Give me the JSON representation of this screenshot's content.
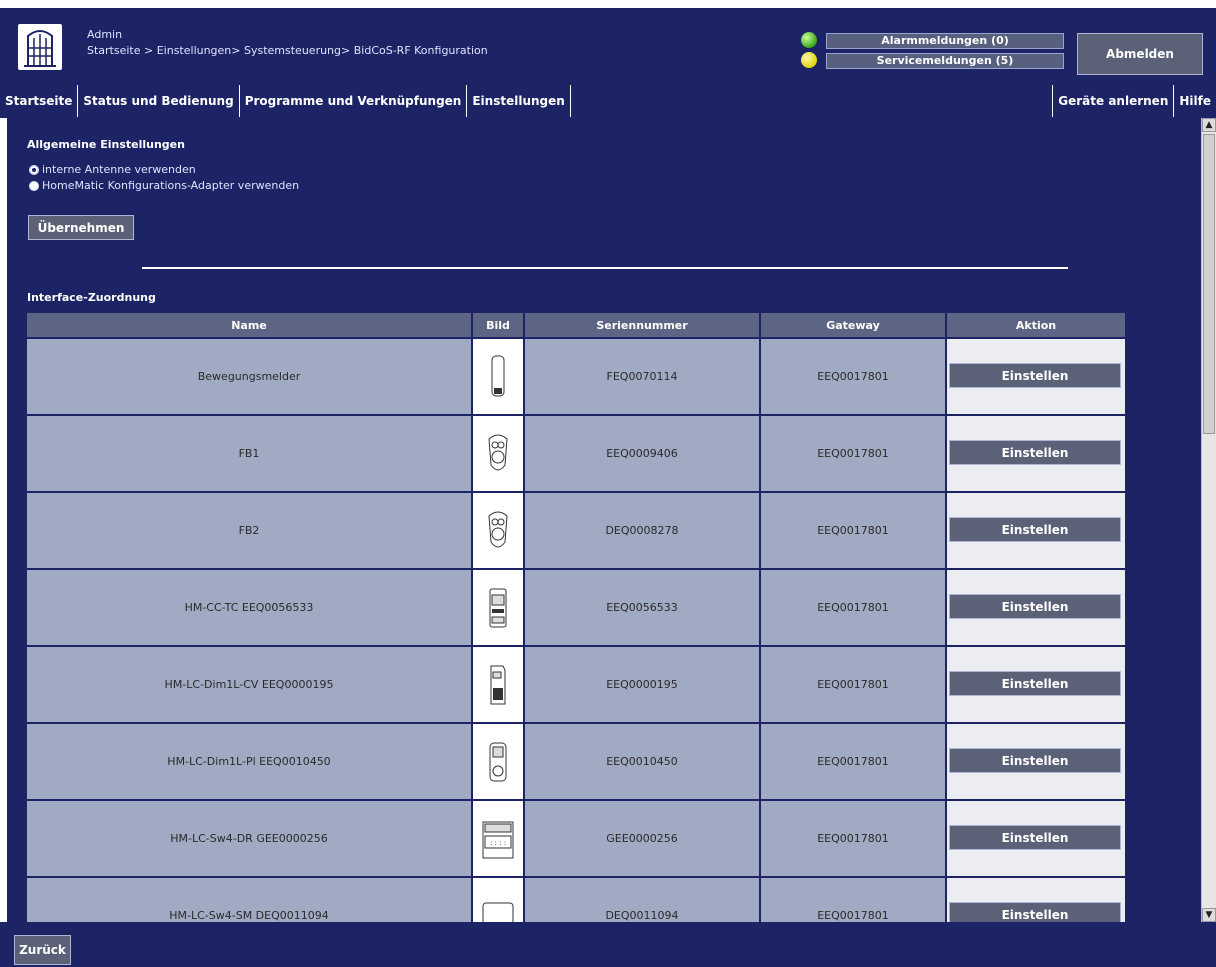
{
  "header": {
    "user": "Admin",
    "breadcrumb": "Startseite > Einstellungen> Systemsteuerung> BidCoS-RF Konfiguration",
    "alarm": "Alarmmeldungen (0)",
    "service": "Servicemeldungen (5)",
    "logout": "Abmelden"
  },
  "nav": {
    "left": [
      "Startseite",
      "Status und Bedienung",
      "Programme und Verknüpfungen",
      "Einstellungen"
    ],
    "right": [
      "Geräte anlernen",
      "Hilfe"
    ]
  },
  "general": {
    "title": "Allgemeine Einstellungen",
    "radio1": "interne Antenne verwenden",
    "radio2": "HomeMatic Konfigurations-Adapter verwenden",
    "apply": "Übernehmen"
  },
  "interface": {
    "title": "Interface-Zuordnung",
    "headers": [
      "Name",
      "Bild",
      "Seriennummer",
      "Gateway",
      "Aktion"
    ],
    "rows": [
      {
        "name": "Bewegungsmelder",
        "serial": "FEQ0070114",
        "gateway": "EEQ0017801",
        "action": "Einstellen",
        "icon": "motion-sensor-icon"
      },
      {
        "name": "FB1",
        "serial": "EEQ0009406",
        "gateway": "EEQ0017801",
        "action": "Einstellen",
        "icon": "remote-icon"
      },
      {
        "name": "FB2",
        "serial": "DEQ0008278",
        "gateway": "EEQ0017801",
        "action": "Einstellen",
        "icon": "remote-icon"
      },
      {
        "name": "HM-CC-TC EEQ0056533",
        "serial": "EEQ0056533",
        "gateway": "EEQ0017801",
        "action": "Einstellen",
        "icon": "thermostat-icon"
      },
      {
        "name": "HM-LC-Dim1L-CV EEQ0000195",
        "serial": "EEQ0000195",
        "gateway": "EEQ0017801",
        "action": "Einstellen",
        "icon": "dimmer-icon"
      },
      {
        "name": "HM-LC-Dim1L-Pl EEQ0010450",
        "serial": "EEQ0010450",
        "gateway": "EEQ0017801",
        "action": "Einstellen",
        "icon": "plug-icon"
      },
      {
        "name": "HM-LC-Sw4-DR GEE0000256",
        "serial": "GEE0000256",
        "gateway": "EEQ0017801",
        "action": "Einstellen",
        "icon": "din-rail-switch-icon"
      },
      {
        "name": "HM-LC-Sw4-SM DEQ0011094",
        "serial": "DEQ0011094",
        "gateway": "EEQ0017801",
        "action": "Einstellen",
        "icon": "switch-module-icon"
      }
    ]
  },
  "footer": {
    "back": "Zurück"
  },
  "colors": {
    "navy": "#1d2466",
    "cell": "#a0aac3",
    "button": "#5b6278"
  }
}
